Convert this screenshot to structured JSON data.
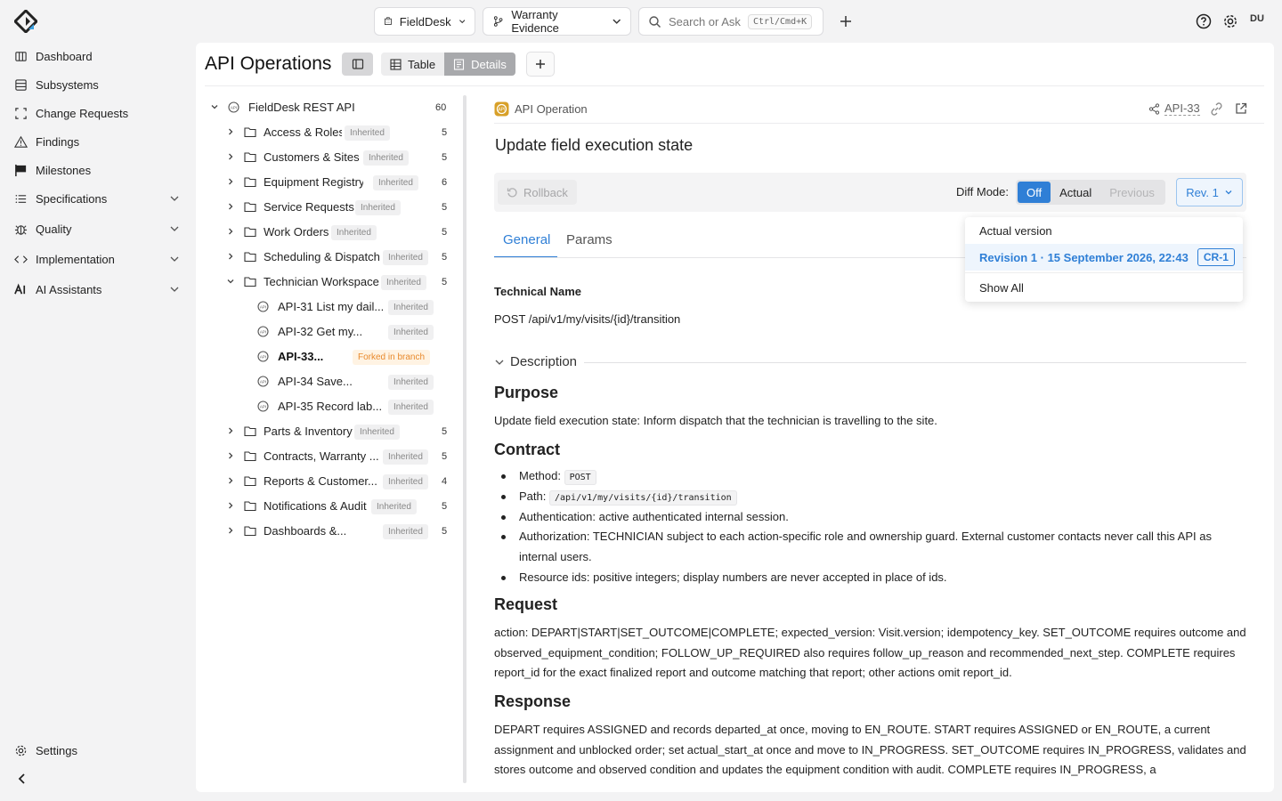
{
  "topbar": {
    "project": "FieldDesk",
    "branch": "Warranty Evidence",
    "search_placeholder": "Search or Ask",
    "search_shortcut": "Ctrl/Cmd+K",
    "avatar": "DU"
  },
  "sidebar": {
    "items": [
      {
        "label": "Dashboard"
      },
      {
        "label": "Subsystems"
      },
      {
        "label": "Change Requests"
      },
      {
        "label": "Findings"
      },
      {
        "label": "Milestones"
      },
      {
        "label": "Specifications"
      },
      {
        "label": "Quality"
      },
      {
        "label": "Implementation"
      },
      {
        "label": "AI Assistants"
      }
    ],
    "settings": "Settings"
  },
  "page": {
    "title": "API Operations",
    "view_table": "Table",
    "view_details": "Details"
  },
  "tree": {
    "root": {
      "label": "FieldDesk REST API",
      "count": "60"
    },
    "groups": [
      {
        "label": "Access & Roles",
        "badge": "Inherited",
        "count": "5"
      },
      {
        "label": "Customers & Sites",
        "badge": "Inherited",
        "count": "5"
      },
      {
        "label": "Equipment Registry",
        "badge": "Inherited",
        "count": "6"
      },
      {
        "label": "Service Requests",
        "badge": "Inherited",
        "count": "5"
      },
      {
        "label": "Work Orders",
        "badge": "Inherited",
        "count": "5"
      },
      {
        "label": "Scheduling & Dispatch",
        "badge": "Inherited",
        "count": "5"
      },
      {
        "label": "Technician Workspace",
        "badge": "Inherited",
        "count": "5"
      },
      {
        "label": "Parts & Inventory",
        "badge": "Inherited",
        "count": "5"
      },
      {
        "label": "Contracts, Warranty ...",
        "badge": "Inherited",
        "count": "5"
      },
      {
        "label": "Reports & Customer...",
        "badge": "Inherited",
        "count": "4"
      },
      {
        "label": "Notifications & Audit",
        "badge": "Inherited",
        "count": "5"
      },
      {
        "label": "Dashboards &...",
        "badge": "Inherited",
        "count": "5"
      }
    ],
    "children": [
      {
        "label": "API-31 List my dail...",
        "badge": "Inherited"
      },
      {
        "label": "API-32 Get my...",
        "badge": "Inherited"
      },
      {
        "label": "API-33...",
        "badge": "Forked in branch"
      },
      {
        "label": "API-34 Save...",
        "badge": "Inherited"
      },
      {
        "label": "API-35 Record lab...",
        "badge": "Inherited"
      }
    ]
  },
  "detail": {
    "type_label": "API Operation",
    "id": "API-33",
    "title": "Update field execution state",
    "rollback": "Rollback",
    "diff_mode_label": "Diff Mode:",
    "diff_off": "Off",
    "diff_actual": "Actual",
    "diff_previous": "Previous",
    "rev_button": "Rev. 1",
    "tab_general": "General",
    "tab_params": "Params",
    "technical_name_label": "Technical Name",
    "technical_name": "POST /api/v1/my/visits/{id}/transition",
    "description_label": "Description",
    "purpose_heading": "Purpose",
    "purpose_text": "Update field execution state: Inform dispatch that the technician is travelling to the site.",
    "contract_heading": "Contract",
    "contract": {
      "method_label": "Method:",
      "method_value": "POST",
      "path_label": "Path:",
      "path_value": "/api/v1/my/visits/{id}/transition",
      "auth": "Authentication: active authenticated internal session.",
      "authz": "Authorization: TECHNICIAN subject to each action-specific role and ownership guard. External customer contacts never call this API as internal users.",
      "ids": "Resource ids: positive integers; display numbers are never accepted in place of ids."
    },
    "request_heading": "Request",
    "request_text": "action: DEPART|START|SET_OUTCOME|COMPLETE; expected_version: Visit.version; idempotency_key. SET_OUTCOME requires outcome and observed_equipment_condition; FOLLOW_UP_REQUIRED also requires follow_up_reason and recommended_next_step. COMPLETE requires report_id for the exact finalized report and outcome matching that report; other actions omit report_id.",
    "response_heading": "Response",
    "response_text": "DEPART requires ASSIGNED and records departed_at once, moving to EN_ROUTE. START requires ASSIGNED or EN_ROUTE, a current assignment and unblocked order; set actual_start_at once and move to IN_PROGRESS. SET_OUTCOME requires IN_PROGRESS, validates and stores outcome and observed condition and updates the equipment condition with audit. COMPLETE requires IN_PROGRESS, a"
  },
  "dropdown": {
    "actual": "Actual version",
    "revision": "Revision 1 · 15 September 2026, 22:43",
    "revision_badge": "CR-1",
    "show_all": "Show All"
  },
  "colors": {
    "accent": "#2f7fd6",
    "fork": "#e8892c"
  }
}
